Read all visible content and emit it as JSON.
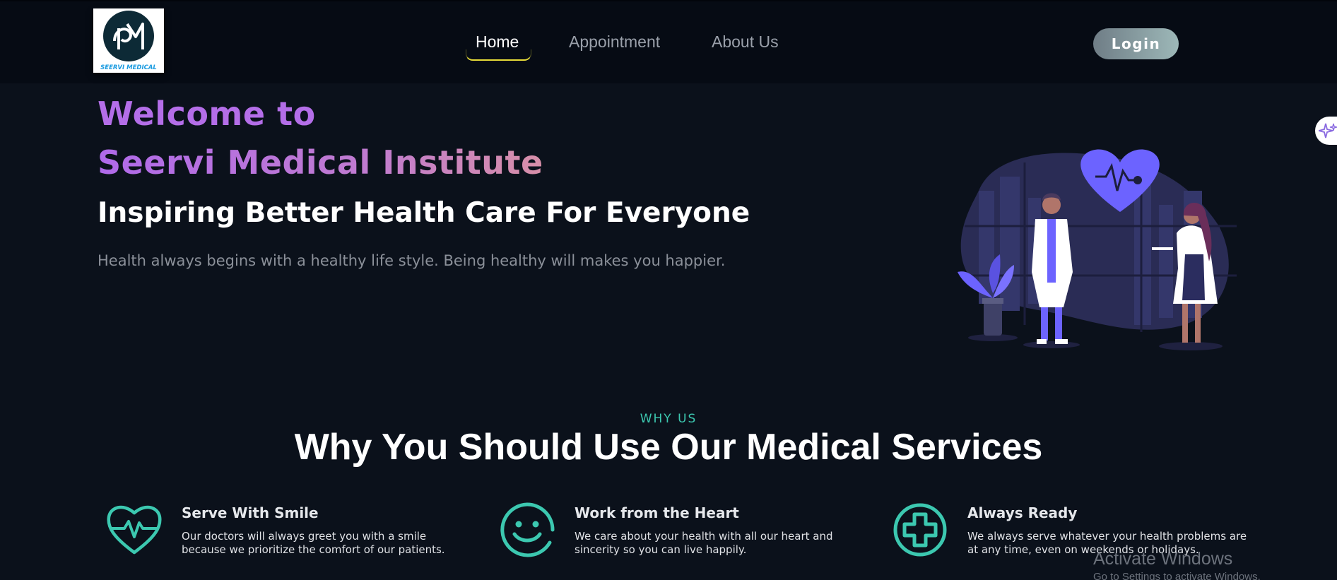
{
  "navbar": {
    "logo_text": "SEERVI MEDICAL",
    "links": [
      {
        "label": "Home",
        "active": true
      },
      {
        "label": "Appointment",
        "active": false
      },
      {
        "label": "About Us",
        "active": false
      }
    ],
    "login_label": "Login"
  },
  "hero": {
    "welcome": "Welcome to",
    "name": "Seervi Medical Institute",
    "tagline": "Inspiring Better Health Care For Everyone",
    "description": "Health always begins with a healthy life style. Being healthy will makes you happier."
  },
  "why": {
    "kicker": "WHY US",
    "title": "Why You Should Use Our Medical Services",
    "features": [
      {
        "icon": "heartbeat-icon",
        "title": "Serve With Smile",
        "description": "Our doctors will always greet you with a smile because we prioritize the comfort of our patients."
      },
      {
        "icon": "smile-icon",
        "title": "Work from the Heart",
        "description": "We care about your health with all our heart and sincerity so you can live happily."
      },
      {
        "icon": "medical-cross-icon",
        "title": "Always Ready",
        "description": "We always serve whatever your health problems are at any time, even on weekends or holidays."
      }
    ]
  },
  "watermark": {
    "title": "Activate Windows",
    "subtitle": "Go to Settings to activate Windows."
  },
  "colors": {
    "background": "#0b111b",
    "navbar": "#060b14",
    "accent_purple": "#b46ee8",
    "accent_teal": "#3cc8b0",
    "illustration_purple": "#6c63ff",
    "active_underline": "#e6dc39"
  }
}
